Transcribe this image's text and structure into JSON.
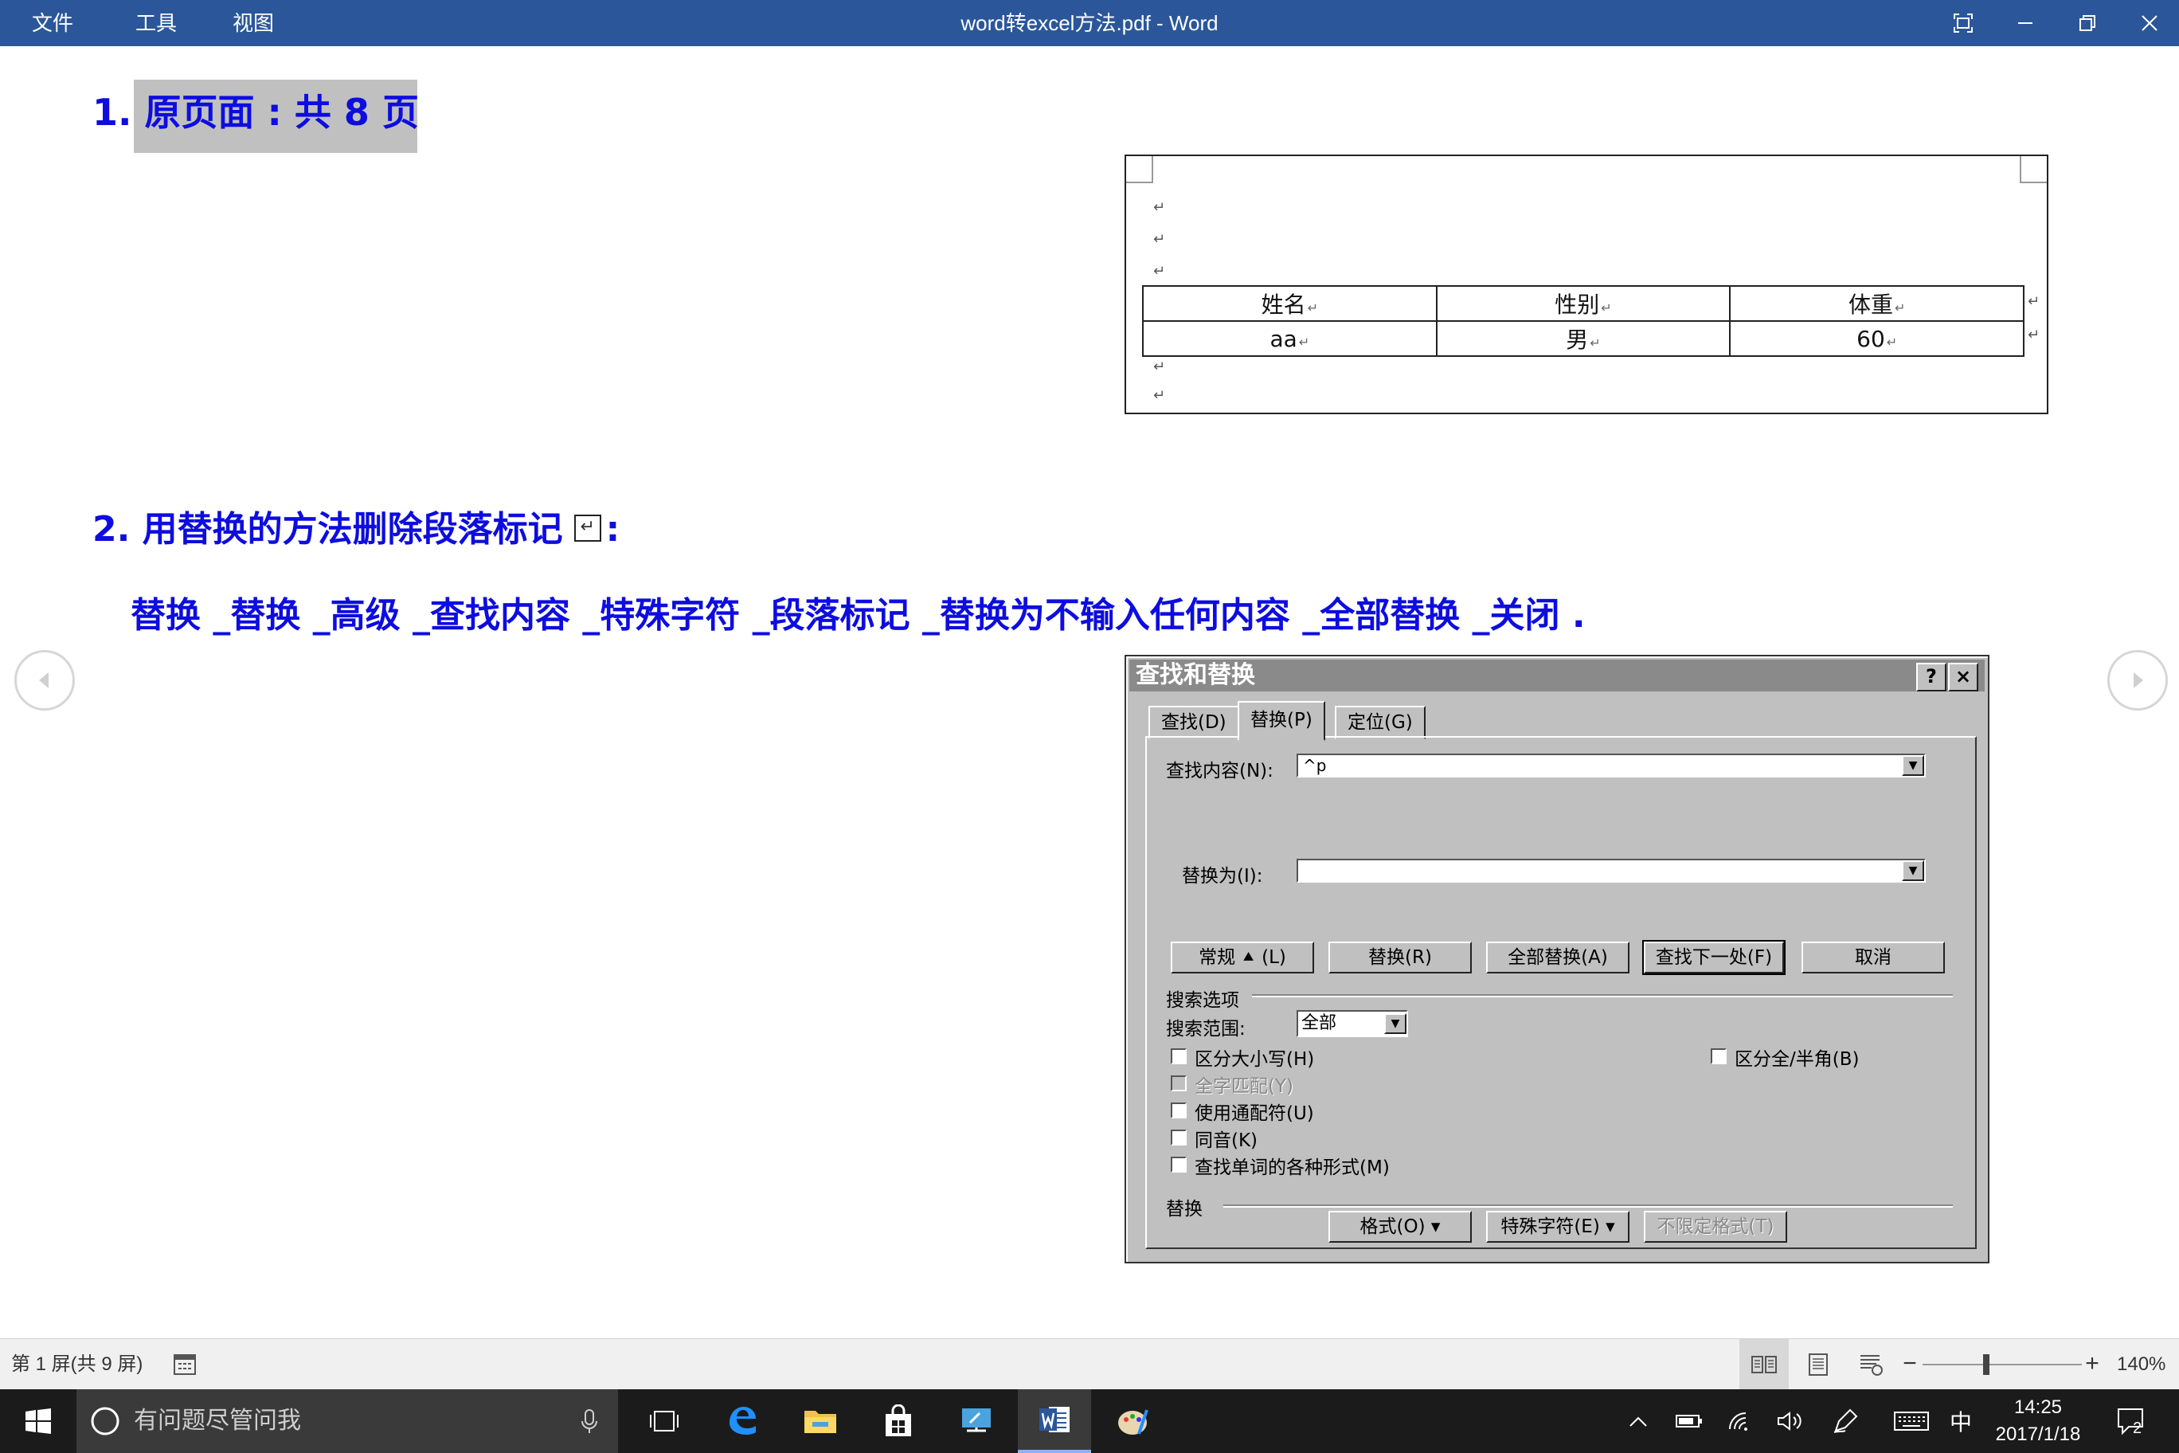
{
  "titlebar": {
    "menu": [
      "文件",
      "工具",
      "视图"
    ],
    "title": "word转excel方法.pdf  -  Word"
  },
  "document": {
    "heading1": "1. 原页面 : 共 8 页",
    "heading2": "2. 用替换的方法删除段落标记",
    "heading2_suffix": ":",
    "paragraph_mark": "↵",
    "steps": "替换 _替换 _高级 _查找内容 _特殊字符 _段落标记 _替换为不输入任何内容 _全部替换 _关闭 ."
  },
  "preview_table": {
    "headers": [
      "姓名",
      "性别",
      "体重"
    ],
    "row": [
      "aa",
      "男",
      "60"
    ],
    "mark": "↵"
  },
  "dialog": {
    "title": "查找和替换",
    "help": "?",
    "close": "×",
    "tabs": [
      "查找(D)",
      "替换(P)",
      "定位(G)"
    ],
    "find_label": "查找内容(N):",
    "find_value": "^p",
    "replace_label": "替换为(I):",
    "replace_value": "",
    "buttons": [
      "常规 ⯅ (L)",
      "替换(R)",
      "全部替换(A)",
      "查找下一处(F)",
      "取消"
    ],
    "search_options_label": "搜索选项",
    "search_scope_label": "搜索范围:",
    "search_scope_value": "全部",
    "checkboxes": [
      "区分大小写(H)",
      "全字匹配(Y)",
      "使用通配符(U)",
      "同音(K)",
      "查找单词的各种形式(M)"
    ],
    "checkbox_fullhalf": "区分全/半角(B)",
    "replace_section_label": "替换",
    "bottom_buttons": [
      "格式(O) ▾",
      "特殊字符(E) ▾",
      "不限定格式(T)"
    ]
  },
  "statusbar": {
    "page_info": "第 1 屏(共 9 屏)",
    "zoom": "140%",
    "zoom_level": 0.4
  },
  "taskbar": {
    "search_placeholder": "有问题尽管问我",
    "ime": "中",
    "time": "14:25",
    "date": "2017/1/18",
    "notifications": "2"
  }
}
